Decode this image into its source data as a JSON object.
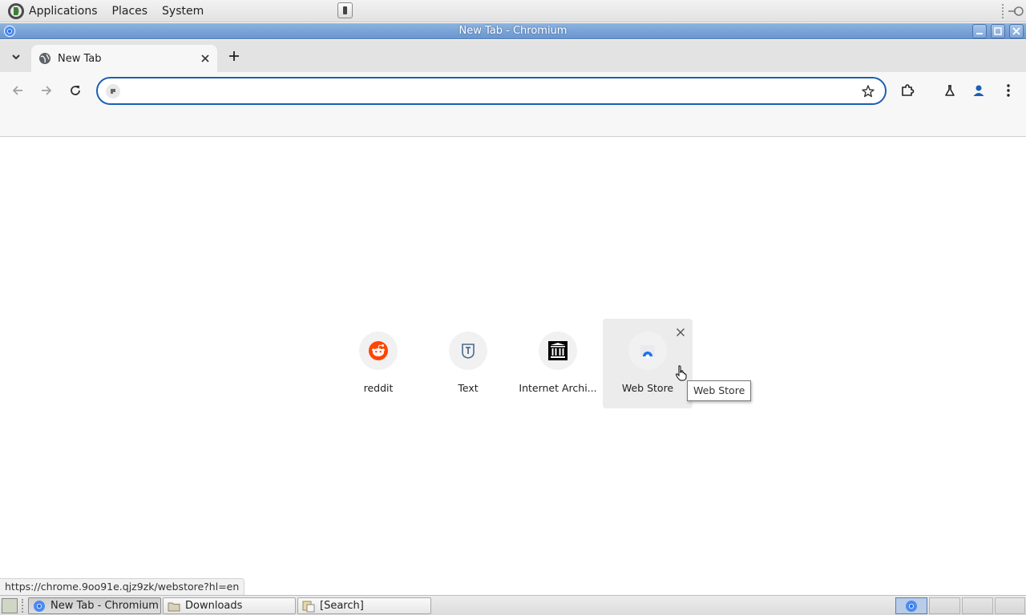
{
  "top_panel": {
    "menus": [
      "Applications",
      "Places",
      "System"
    ]
  },
  "window": {
    "title": "New Tab - Chromium"
  },
  "tabstrip": {
    "tab_title": "New Tab"
  },
  "omnibox": {
    "value": "",
    "placeholder": ""
  },
  "shortcuts": [
    {
      "label": "reddit",
      "icon": "reddit-icon"
    },
    {
      "label": "Text",
      "icon": "text-t-icon"
    },
    {
      "label": "Internet Archi...",
      "icon": "internet-archive-icon"
    },
    {
      "label": "Web Store",
      "icon": "web-store-icon"
    }
  ],
  "tooltip": "Web Store",
  "status_url": "https://chrome.9oo91e.qjz9zk/webstore?hl=en",
  "taskbar": {
    "items": [
      "New Tab - Chromium",
      "Downloads",
      "[Search]"
    ]
  },
  "colors": {
    "accent": "#1a5fb4",
    "titlebar": "#7ea6da",
    "reddit": "#ff4500"
  }
}
